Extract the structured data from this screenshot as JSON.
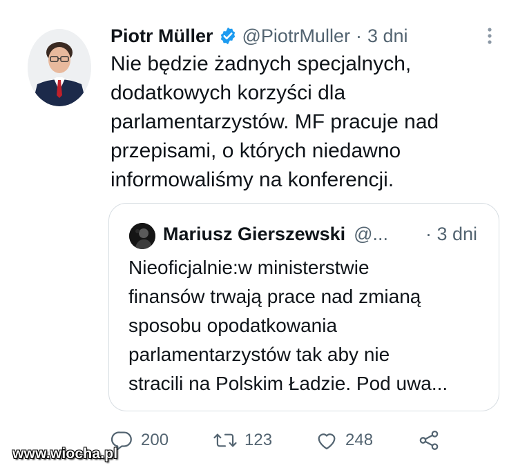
{
  "tweet": {
    "author_name": "Piotr Müller",
    "handle": "@PiotrMuller",
    "separator": "·",
    "time": "3 dni",
    "text": "Nie będzie żadnych specjalnych,\ndodatkowych korzyści dla\nparlamentarzystów. MF pracuje nad\nprzepisami, o których niedawno\ninformowaliśmy na konferencji.",
    "icons": {
      "verified": "verified-badge-icon",
      "more": "more-vertical-icon"
    },
    "colors": {
      "verified": "#1d9bf0",
      "secondary_text": "#536471"
    }
  },
  "quoted_tweet": {
    "author_name": "Mariusz Gierszewski",
    "handle": "@...",
    "time": "· 3 dni",
    "text": "Nieoficjalnie:w ministerstwie\nfinansów trwają prace nad zmianą\nsposobu opodatkowania\nparlamentarzystów tak aby nie\nstracili na Polskim Ładzie. Pod uwa..."
  },
  "actions": {
    "reply": {
      "icon": "reply-icon",
      "count": "200"
    },
    "retweet": {
      "icon": "retweet-icon",
      "count": "123"
    },
    "like": {
      "icon": "heart-icon",
      "count": "248"
    },
    "share": {
      "icon": "share-icon"
    }
  },
  "watermark": "www.wiocha.pl"
}
